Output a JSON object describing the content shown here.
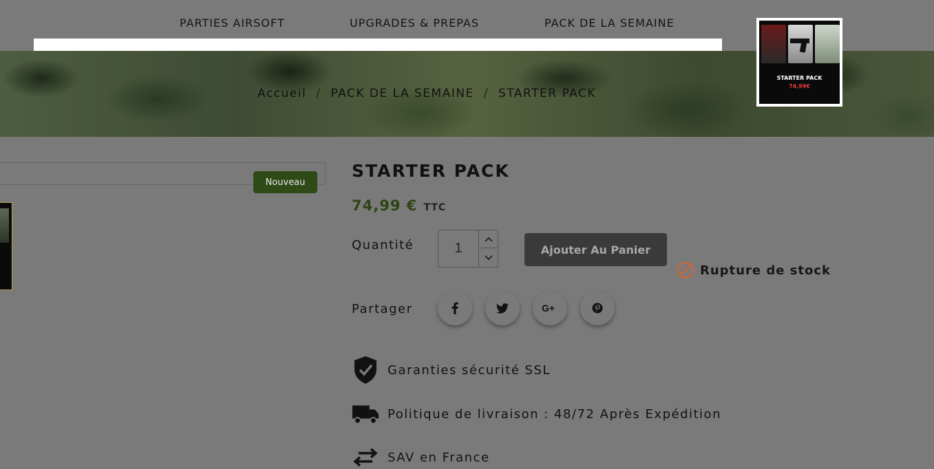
{
  "nav": {
    "items": [
      "PARTIES AIRSOFT",
      "UPGRADES & PREPAS",
      "PACK DE LA SEMAINE"
    ]
  },
  "breadcrumb": {
    "items": [
      "Accueil",
      "PACK DE LA SEMAINE",
      "STARTER PACK"
    ],
    "separator": "/"
  },
  "promo": {
    "title": "STARTER PACK",
    "price": "74,99€"
  },
  "gallery": {
    "badge": "Nouveau"
  },
  "product": {
    "title": "STARTER PACK",
    "price": "74,99 €",
    "tax_label": "TTC",
    "quantity_label": "Quantité",
    "quantity_value": "1",
    "add_to_cart_label": "Ajouter Au Panier",
    "stock_status": "Rupture de stock",
    "share_label": "Partager"
  },
  "share": {
    "icons": [
      "facebook-icon",
      "twitter-icon",
      "google-plus-icon",
      "pinterest-icon"
    ]
  },
  "reassurance": [
    {
      "icon": "shield-check-icon",
      "text": "Garanties sécurité SSL"
    },
    {
      "icon": "truck-icon",
      "text": "Politique de livraison : 48/72 Après Expédition"
    },
    {
      "icon": "swap-arrows-icon",
      "text": "SAV en France"
    }
  ],
  "colors": {
    "price": "#2f4414",
    "badge_bg": "#2e4a16",
    "stock_icon": "#c8683a",
    "button_bg": "#3a3a3a"
  }
}
